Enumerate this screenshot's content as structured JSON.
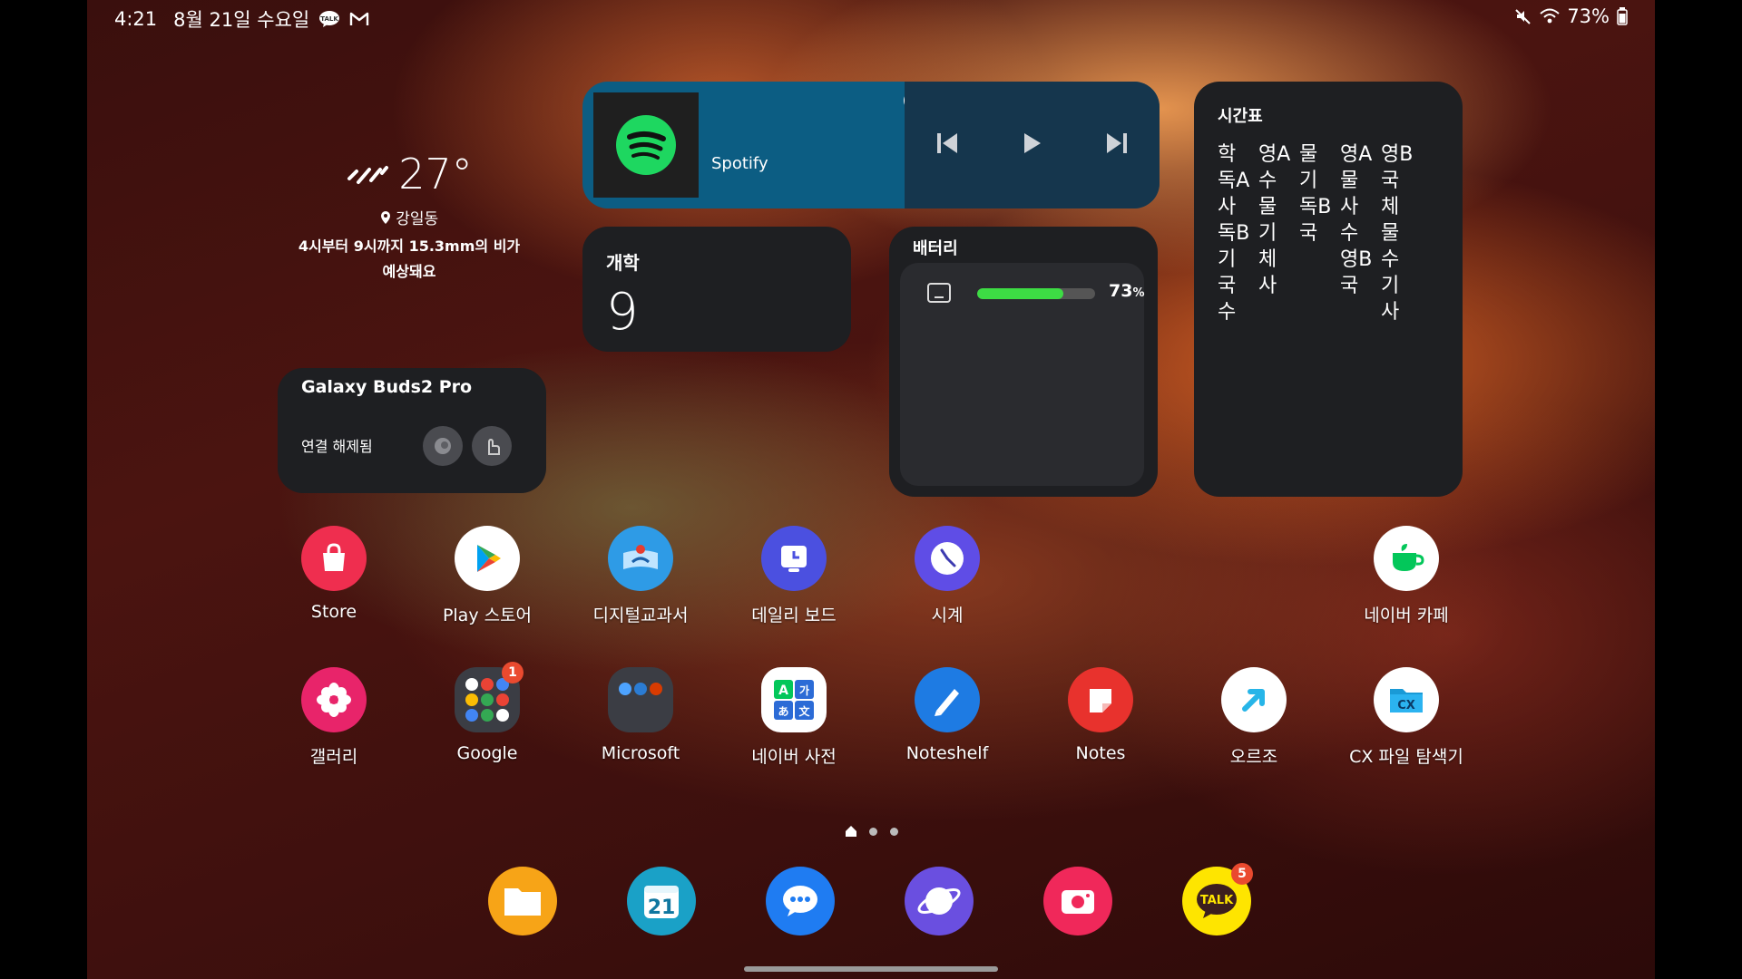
{
  "status_bar": {
    "time": "4:21",
    "date": "8월 21일 수요일",
    "talk_icon_text": "TALK",
    "battery_pct": "73%"
  },
  "weather": {
    "temp": "27°",
    "location": "강일동",
    "desc_line1": "4시부터 9시까지 15.3mm의 비가",
    "desc_line2": "예상돼요"
  },
  "spotify": {
    "title": "Spotify"
  },
  "counter": {
    "title": "개학",
    "value": "9"
  },
  "buds": {
    "title": "Galaxy Buds2 Pro",
    "status": "연결 해제됨"
  },
  "battery": {
    "title": "배터리",
    "percent_value": "73",
    "percent_unit": "%",
    "level": 0.73
  },
  "timetable": {
    "title": "시간표",
    "columns": [
      [
        "학",
        "독A",
        "사",
        "독B",
        "기",
        "국",
        "수"
      ],
      [
        "영A",
        "수",
        "물",
        "기",
        "체",
        "사",
        ""
      ],
      [
        "물",
        "기",
        "독B",
        "국",
        "",
        "",
        ""
      ],
      [
        "영A",
        "물",
        "사",
        "수",
        "영B",
        "국",
        ""
      ],
      [
        "영B",
        "국",
        "체",
        "물",
        "수",
        "기",
        "사"
      ]
    ]
  },
  "apps_row1": [
    {
      "label": "Store"
    },
    {
      "label": "Play 스토어"
    },
    {
      "label": "디지털교과서"
    },
    {
      "label": "데일리 보드"
    },
    {
      "label": "시계"
    },
    {
      "label": "네이버 카페"
    }
  ],
  "apps_row2": [
    {
      "label": "갤러리"
    },
    {
      "label": "Google",
      "badge": "1"
    },
    {
      "label": "Microsoft"
    },
    {
      "label": "네이버 사전"
    },
    {
      "label": "Noteshelf"
    },
    {
      "label": "Notes"
    },
    {
      "label": "오르조"
    },
    {
      "label": "CX 파일 탐색기"
    }
  ],
  "dictionary_icon": {
    "a": "A",
    "ga": "가",
    "a_jp": "あ",
    "wen": "文"
  },
  "cx_icon": {
    "text": "CX"
  },
  "dock": {
    "calendar_day": "21",
    "talk_label": "TALK",
    "talk_badge": "5"
  },
  "colors": {
    "spotify_green": "#1ed760",
    "spotify_blue": "#0c5d83",
    "widget_bg": "#1e1f22",
    "battery_fill": "#3ddc44",
    "badge_red": "#ea4a2f"
  }
}
